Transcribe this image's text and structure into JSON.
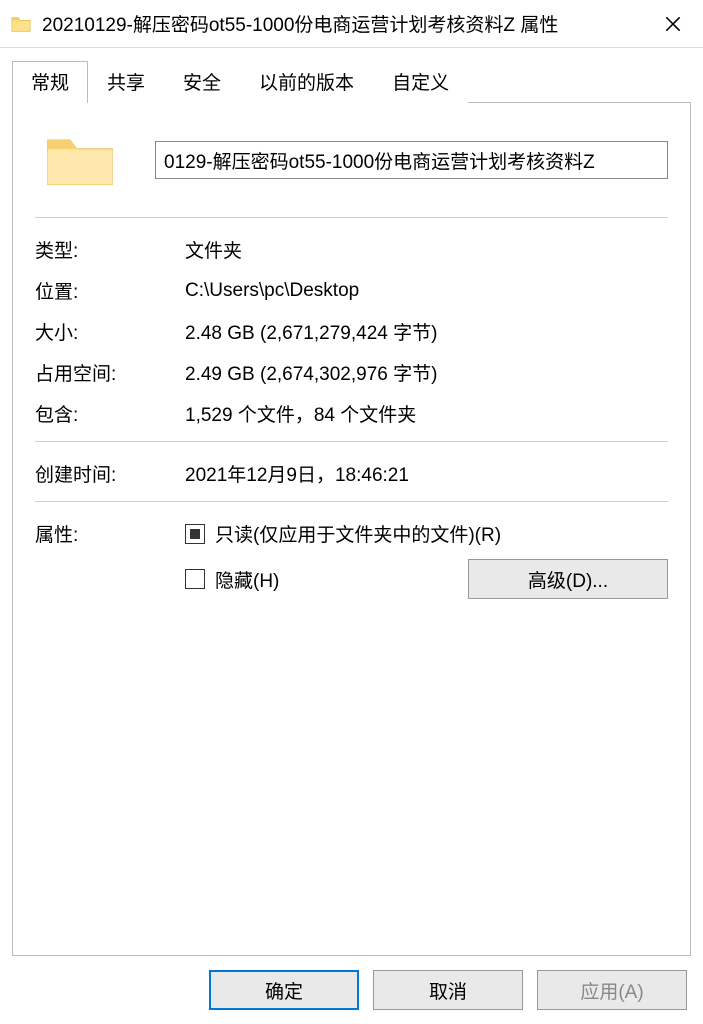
{
  "titlebar": {
    "title": "20210129-解压密码ot55-1000份电商运营计划考核资料Z 属性"
  },
  "tabs": {
    "general": "常规",
    "sharing": "共享",
    "security": "安全",
    "previous": "以前的版本",
    "customize": "自定义"
  },
  "name_value": "0129-解压密码ot55-1000份电商运营计划考核资料Z",
  "labels": {
    "type": "类型:",
    "location": "位置:",
    "size": "大小:",
    "size_on_disk": "占用空间:",
    "contains": "包含:",
    "created": "创建时间:",
    "attributes": "属性:"
  },
  "values": {
    "type": "文件夹",
    "location": "C:\\Users\\pc\\Desktop",
    "size": "2.48 GB (2,671,279,424 字节)",
    "size_on_disk": "2.49 GB (2,674,302,976 字节)",
    "contains": "1,529 个文件，84 个文件夹",
    "created": "2021年12月9日，18:46:21"
  },
  "attributes": {
    "readonly_label": "只读(仅应用于文件夹中的文件)(R)",
    "hidden_label": "隐藏(H)",
    "advanced_button": "高级(D)..."
  },
  "buttons": {
    "ok": "确定",
    "cancel": "取消",
    "apply": "应用(A)"
  }
}
